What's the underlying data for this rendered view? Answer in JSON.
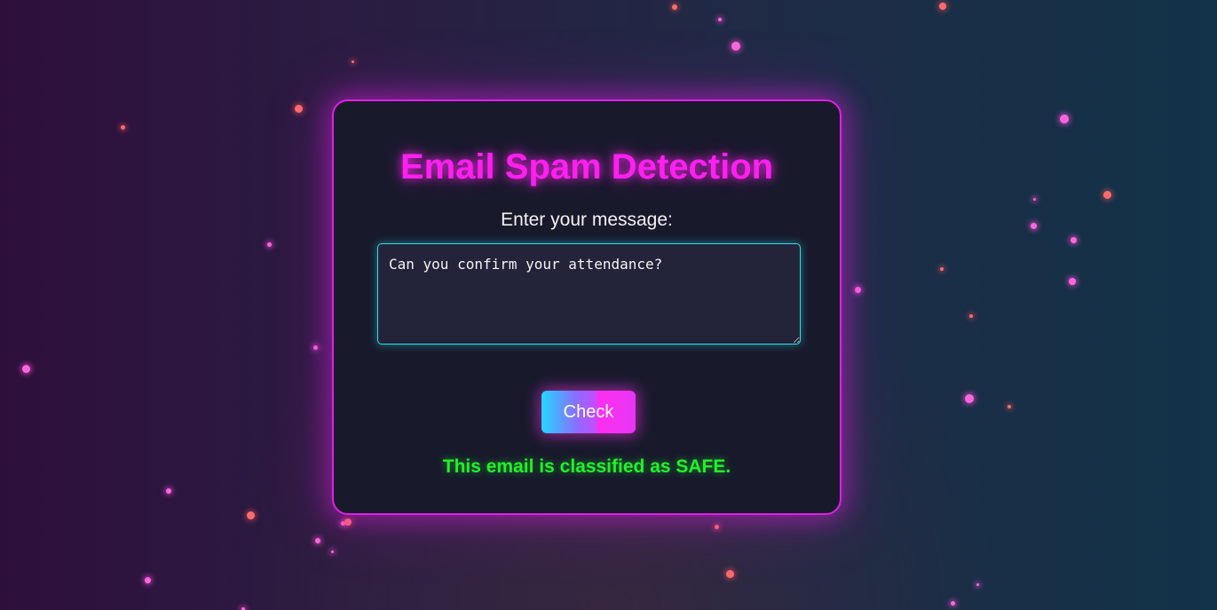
{
  "card": {
    "title": "Email Spam Detection",
    "input_label": "Enter your message:",
    "message_value": "Can you confirm your attendance?",
    "check_button_label": "Check",
    "result_text": "This email is classified as SAFE."
  },
  "theme": {
    "accent_magenta": "#e21ee6",
    "input_border_cyan": "#2fe0e8",
    "safe_green": "#22f02a"
  }
}
